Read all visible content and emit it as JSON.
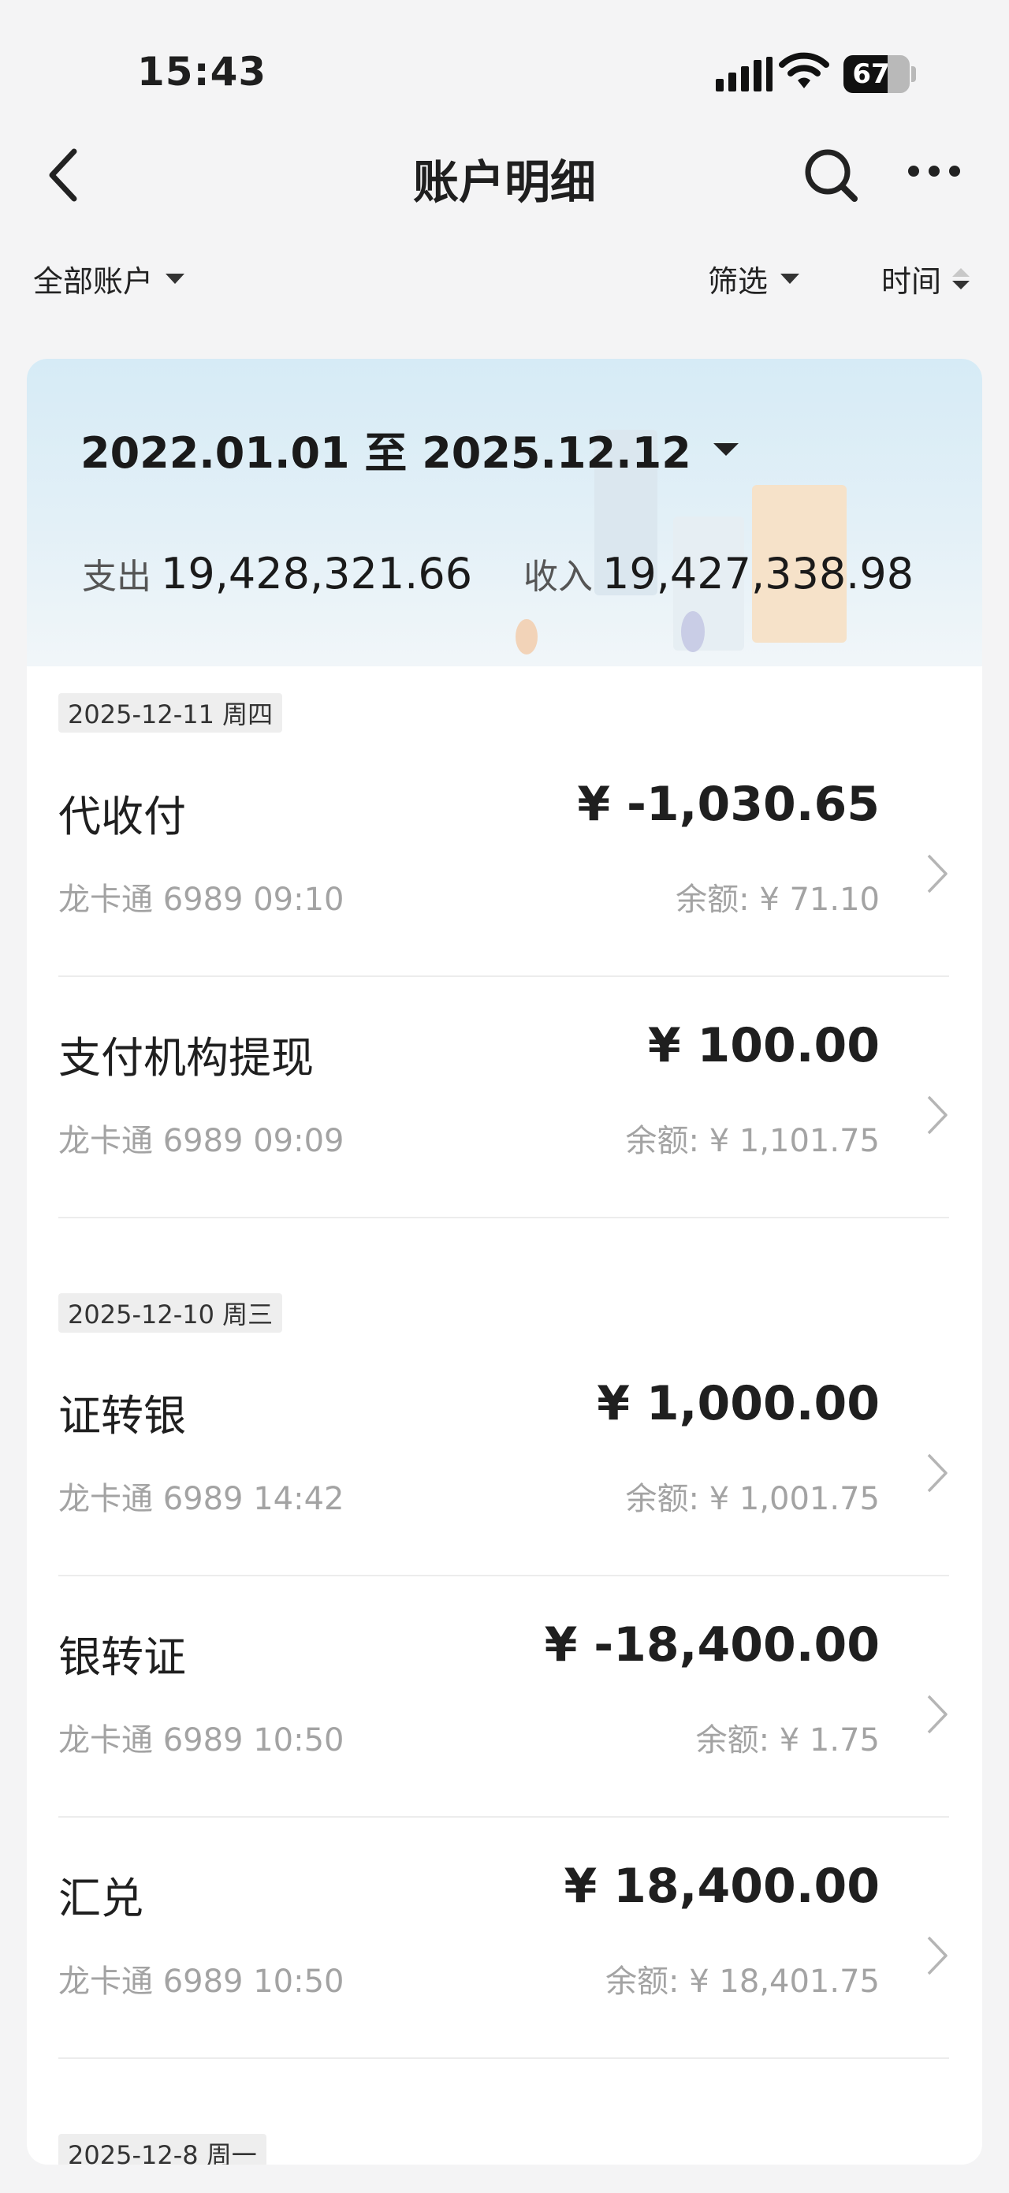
{
  "status_bar": {
    "time": "15:43",
    "battery": "67",
    "battery_level": 0.67
  },
  "nav": {
    "title": "账户明细",
    "icons": [
      "chevron-left-icon",
      "search-icon",
      "more-icon"
    ]
  },
  "filters": {
    "accounts": "全部账户",
    "filter": "筛选",
    "sort": "时间"
  },
  "summary": {
    "date_range": "2022.01.01 至 2025.12.12",
    "expense_label": "支出",
    "expense": "19,428,321.66",
    "income_label": "收入",
    "income": "19,427,338.98"
  },
  "groups": [
    {
      "date": "2025-12-11 周四",
      "items": [
        {
          "name": "代收付",
          "amount": "¥ -1,030.65",
          "meta": "龙卡通 6989 09:10",
          "balance": "余额: ¥ 71.10"
        },
        {
          "name": "支付机构提现",
          "amount": "¥ 100.00",
          "meta": "龙卡通 6989 09:09",
          "balance": "余额: ¥ 1,101.75"
        }
      ]
    },
    {
      "date": "2025-12-10 周三",
      "items": [
        {
          "name": "证转银",
          "amount": "¥ 1,000.00",
          "meta": "龙卡通 6989 14:42",
          "balance": "余额: ¥ 1,001.75"
        },
        {
          "name": "银转证",
          "amount": "¥ -18,400.00",
          "meta": "龙卡通 6989 10:50",
          "balance": "余额: ¥ 1.75"
        },
        {
          "name": "汇兑",
          "amount": "¥ 18,400.00",
          "meta": "龙卡通 6989 10:50",
          "balance": "余额: ¥ 18,401.75"
        }
      ]
    },
    {
      "date": "2025-12-8 周一",
      "items": []
    }
  ]
}
